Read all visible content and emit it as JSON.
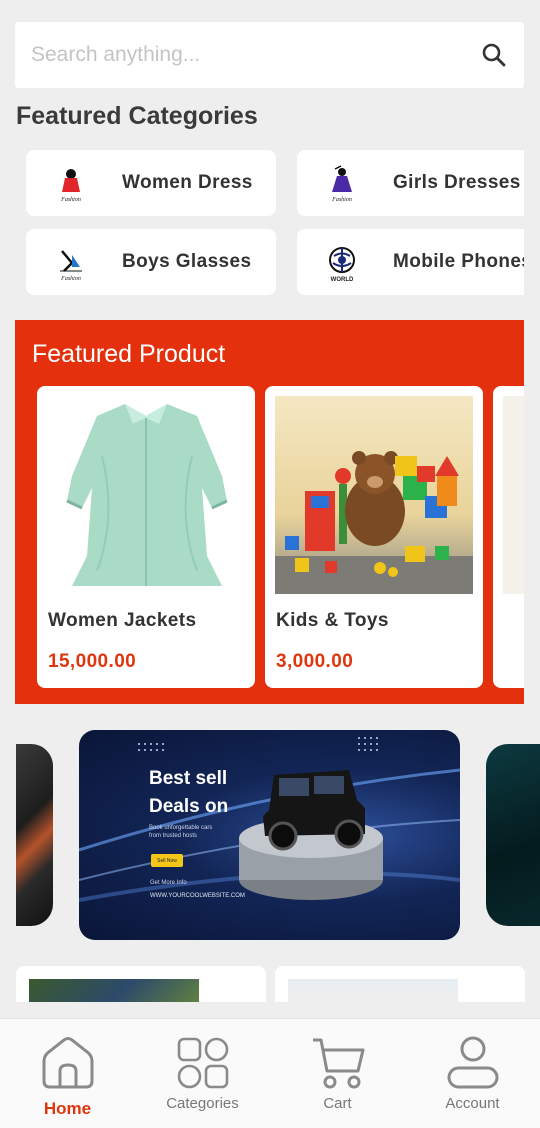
{
  "search": {
    "placeholder": "Search anything..."
  },
  "featured_categories": {
    "title": "Featured Categories",
    "items": [
      {
        "label": "Women Dress",
        "logo_text": "Fashion"
      },
      {
        "label": "Girls Dresses",
        "logo_text": "Fashion"
      },
      {
        "label": "Boys Glasses",
        "logo_text": "Fashion"
      },
      {
        "label": "Mobile Phones",
        "logo_text": "WORLD"
      }
    ]
  },
  "featured_product": {
    "title": "Featured Product",
    "items": [
      {
        "name": "Women Jackets",
        "price": "15,000.00"
      },
      {
        "name": "Kids & Toys",
        "price": "3,000.00"
      }
    ]
  },
  "banner": {
    "title_line1": "Best sell",
    "title_line2": "Deals on",
    "subtitle": "Book unforgettable cars from trusted hosts",
    "button": "Sell Now",
    "more_info": "Get More Info",
    "website": "WWW.YOURCOOLWEBSITE.COM"
  },
  "bottom_nav": {
    "items": [
      {
        "label": "Home",
        "icon": "home-icon",
        "active": true
      },
      {
        "label": "Categories",
        "icon": "categories-icon",
        "active": false
      },
      {
        "label": "Cart",
        "icon": "cart-icon",
        "active": false
      },
      {
        "label": "Account",
        "icon": "account-icon",
        "active": false
      }
    ]
  },
  "colors": {
    "accent": "#e4300c",
    "price": "#e0360e",
    "background": "#eeeeee"
  }
}
